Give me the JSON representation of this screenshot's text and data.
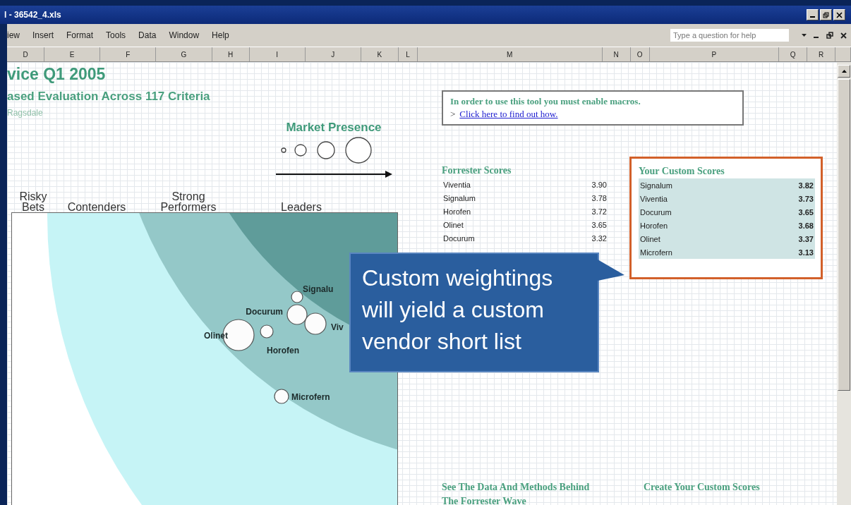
{
  "window": {
    "title": "l - 36542_4.xls"
  },
  "menu": [
    {
      "label": "iew"
    },
    {
      "label": "Insert"
    },
    {
      "label": "Format"
    },
    {
      "label": "Tools"
    },
    {
      "label": "Data"
    },
    {
      "label": "Window"
    },
    {
      "label": "Help"
    }
  ],
  "help_box": {
    "placeholder": "Type a question for help"
  },
  "columns": [
    {
      "label": "D"
    },
    {
      "label": "E"
    },
    {
      "label": "F"
    },
    {
      "label": "G"
    },
    {
      "label": "H"
    },
    {
      "label": "I"
    },
    {
      "label": "J"
    },
    {
      "label": "K"
    },
    {
      "label": "L"
    },
    {
      "label": "M"
    },
    {
      "label": "N"
    },
    {
      "label": "O"
    },
    {
      "label": "P"
    },
    {
      "label": "Q"
    },
    {
      "label": "R"
    }
  ],
  "sheet": {
    "title": "vice Q1 2005",
    "subtitle": "ased Evaluation Across 117 Criteria",
    "author": "Ragsdale",
    "legend": {
      "title": "Market Presence"
    },
    "bands": [
      {
        "label": "Risky Bets"
      },
      {
        "label": "Contenders"
      },
      {
        "label": "Strong Performers"
      },
      {
        "label": "Leaders"
      }
    ],
    "vendors": [
      {
        "label": "Signalu"
      },
      {
        "label": "Docurum"
      },
      {
        "label": "Viv"
      },
      {
        "label": "Olinet"
      },
      {
        "label": "Horofen"
      },
      {
        "label": "Microfern"
      }
    ],
    "macro_notice": {
      "text": "In order to use this tool you must enable macros.",
      "marker": ">",
      "link": "Click here to find out how."
    },
    "forrester_scores": {
      "title": "Forrester Scores",
      "rows": [
        {
          "name": "Viventia",
          "score": "3.90"
        },
        {
          "name": "Signalum",
          "score": "3.78"
        },
        {
          "name": "Horofen",
          "score": "3.72"
        },
        {
          "name": "Olinet",
          "score": "3.65"
        },
        {
          "name": "Docurum",
          "score": "3.32"
        }
      ]
    },
    "custom_scores": {
      "title": "Your Custom Scores",
      "rows": [
        {
          "name": "Signalum",
          "score": "3.82"
        },
        {
          "name": "Viventia",
          "score": "3.73"
        },
        {
          "name": "Docurum",
          "score": "3.65"
        },
        {
          "name": "Horofen",
          "score": "3.68"
        },
        {
          "name": "Olinet",
          "score": "3.37"
        },
        {
          "name": "Microfern",
          "score": "3.13"
        }
      ]
    },
    "callout": {
      "text": "Custom weightings will yield a custom vendor short list"
    },
    "links": [
      {
        "label": "See The Data And Methods Behind The Forrester Wave"
      },
      {
        "label": "Create Your Custom Scores"
      }
    ]
  }
}
